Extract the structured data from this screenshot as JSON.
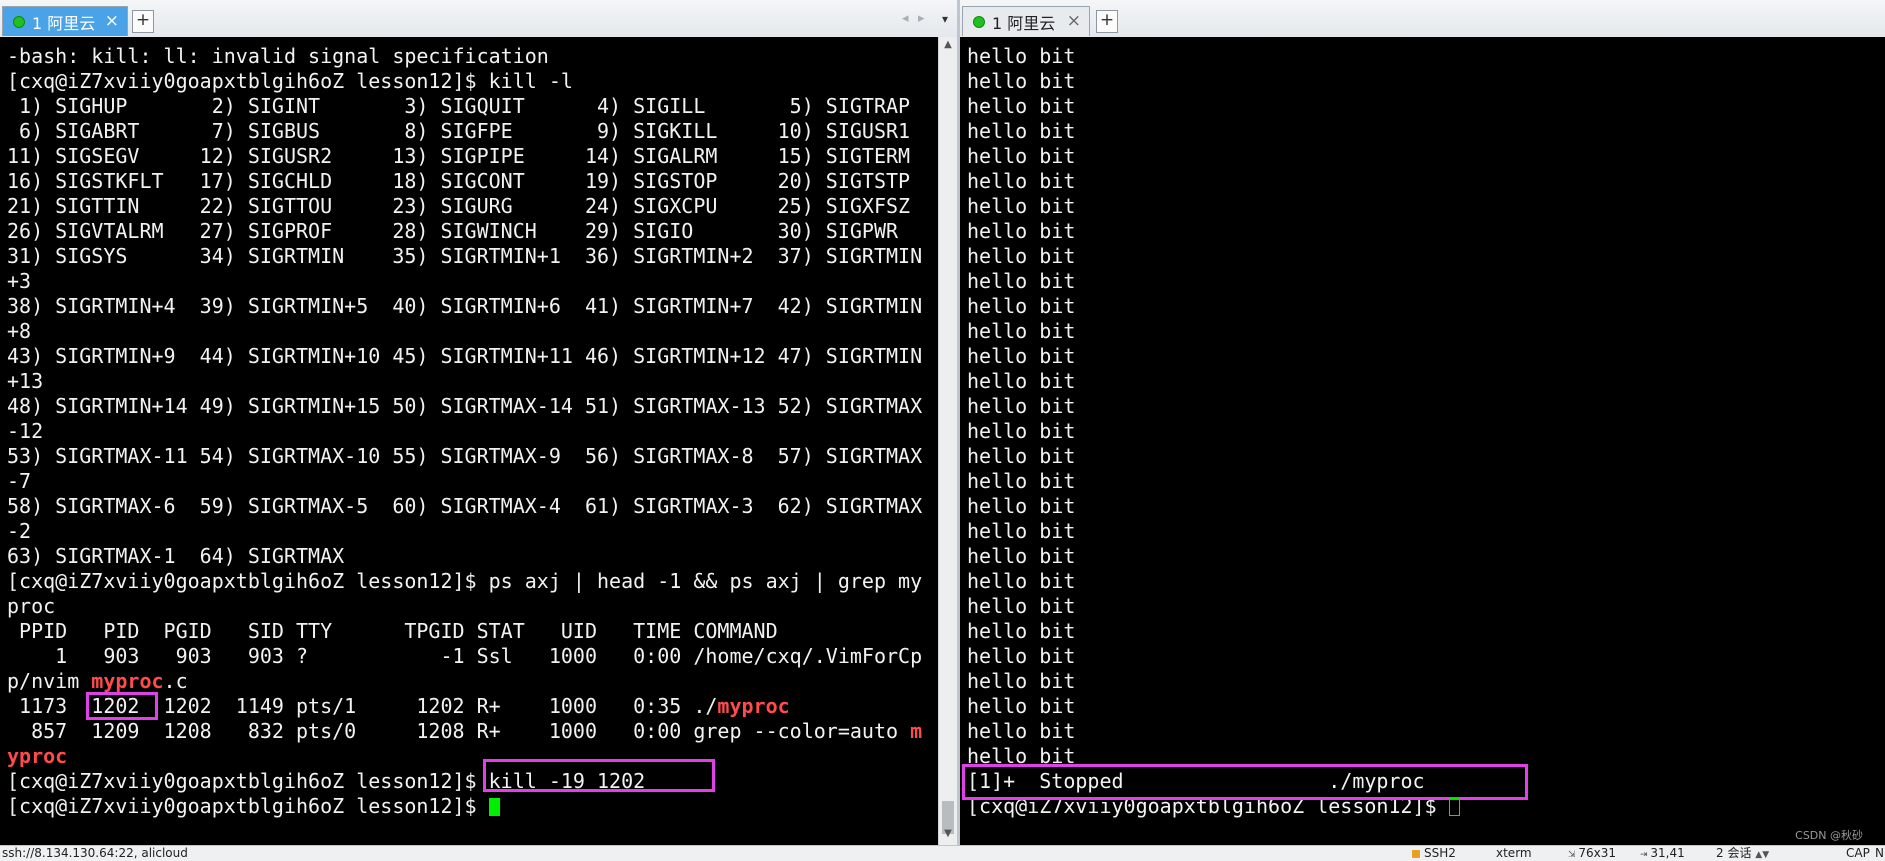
{
  "left_tab": {
    "label": "1 阿里云",
    "close": "×",
    "new_tab": "+"
  },
  "right_tab": {
    "label": "1 阿里云",
    "close": "×",
    "new_tab": "+"
  },
  "tab_nav": {
    "prev": "◂",
    "next": "▸",
    "menu": "▾"
  },
  "left_terminal": {
    "lines": [
      "-bash: kill: ll: invalid signal specification",
      "[cxq@iZ7xviiy0goapxtblgih6oZ lesson12]$ kill -l",
      " 1) SIGHUP       2) SIGINT       3) SIGQUIT      4) SIGILL       5) SIGTRAP",
      " 6) SIGABRT      7) SIGBUS       8) SIGFPE       9) SIGKILL     10) SIGUSR1",
      "11) SIGSEGV     12) SIGUSR2     13) SIGPIPE     14) SIGALRM     15) SIGTERM",
      "16) SIGSTKFLT   17) SIGCHLD     18) SIGCONT     19) SIGSTOP     20) SIGTSTP",
      "21) SIGTTIN     22) SIGTTOU     23) SIGURG      24) SIGXCPU     25) SIGXFSZ",
      "26) SIGVTALRM   27) SIGPROF     28) SIGWINCH    29) SIGIO       30) SIGPWR",
      "31) SIGSYS      34) SIGRTMIN    35) SIGRTMIN+1  36) SIGRTMIN+2  37) SIGRTMIN",
      "+3",
      "38) SIGRTMIN+4  39) SIGRTMIN+5  40) SIGRTMIN+6  41) SIGRTMIN+7  42) SIGRTMIN",
      "+8",
      "43) SIGRTMIN+9  44) SIGRTMIN+10 45) SIGRTMIN+11 46) SIGRTMIN+12 47) SIGRTMIN",
      "+13",
      "48) SIGRTMIN+14 49) SIGRTMIN+15 50) SIGRTMAX-14 51) SIGRTMAX-13 52) SIGRTMAX",
      "-12",
      "53) SIGRTMAX-11 54) SIGRTMAX-10 55) SIGRTMAX-9  56) SIGRTMAX-8  57) SIGRTMAX",
      "-7",
      "58) SIGRTMAX-6  59) SIGRTMAX-5  60) SIGRTMAX-4  61) SIGRTMAX-3  62) SIGRTMAX",
      "-2",
      "63) SIGRTMAX-1  64) SIGRTMAX",
      "[cxq@iZ7xviiy0goapxtblgih6oZ lesson12]$ ps axj | head -1 && ps axj | grep my",
      "proc",
      " PPID   PID  PGID   SID TTY      TPGID STAT   UID   TIME COMMAND",
      "    1   903   903   903 ?           -1 Ssl   1000   0:00 /home/cxq/.VimForCp",
      [
        "p/nvim ",
        "myproc",
        ".c"
      ],
      [
        " 1173  1202  1202  1149 pts/1     1202 R+    1000   0:35 ./",
        "myproc",
        ""
      ],
      [
        "  857  1209  1208   832 pts/0     1208 R+    1000   0:00 grep --color=auto ",
        "m",
        ""
      ],
      [
        "",
        "yproc",
        ""
      ],
      "[cxq@iZ7xviiy0goapxtblgih6oZ lesson12]$ kill -19 1202",
      "[cxq@iZ7xviiy0goapxtblgih6oZ lesson12]$ "
    ]
  },
  "right_terminal": {
    "hello_line": "hello bit",
    "hello_count": 29,
    "lines_after": [
      "[1]+  Stopped                 ./myproc",
      "[cxq@iZ7xviiy0goapxtblgih6oZ lesson12]$ "
    ]
  },
  "statusbar": {
    "connection": "ssh://8.134.130.64:22, alicloud",
    "protocol": "SSH2",
    "terminal_type": "xterm",
    "size": "76x31",
    "cursor_pos": "31,41",
    "sessions": "2 会话",
    "caps": "CAP",
    "num": "N"
  },
  "watermark": "CSDN @秋砂"
}
